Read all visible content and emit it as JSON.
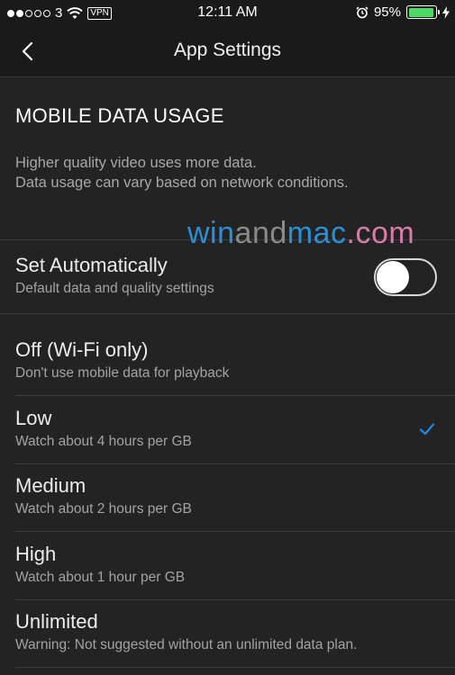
{
  "status_bar": {
    "carrier": "3",
    "vpn": "VPN",
    "time": "12:11 AM",
    "battery": "95%",
    "battery_level": 0.95,
    "accent_color": "#4cd964"
  },
  "nav": {
    "title": "App Settings"
  },
  "section": {
    "title": "MOBILE DATA USAGE",
    "description_line1": "Higher quality video uses more data.",
    "description_line2": "Data usage can vary based on network conditions."
  },
  "watermark": {
    "part1": "win",
    "part2": "and",
    "part3": "mac",
    "part4": ".com"
  },
  "auto_setting": {
    "title": "Set Automatically",
    "subtitle": "Default data and quality settings",
    "enabled": false
  },
  "options": [
    {
      "title": "Off (Wi-Fi only)",
      "subtitle": "Don't use mobile data for playback",
      "selected": false
    },
    {
      "title": "Low",
      "subtitle": "Watch about 4 hours per GB",
      "selected": true
    },
    {
      "title": "Medium",
      "subtitle": "Watch about 2 hours per GB",
      "selected": false
    },
    {
      "title": "High",
      "subtitle": "Watch about 1 hour per GB",
      "selected": false
    },
    {
      "title": "Unlimited",
      "subtitle": "Warning: Not suggested without an unlimited data plan.",
      "selected": false
    }
  ],
  "colors": {
    "background": "#232323",
    "check_color": "#1e88e5"
  }
}
